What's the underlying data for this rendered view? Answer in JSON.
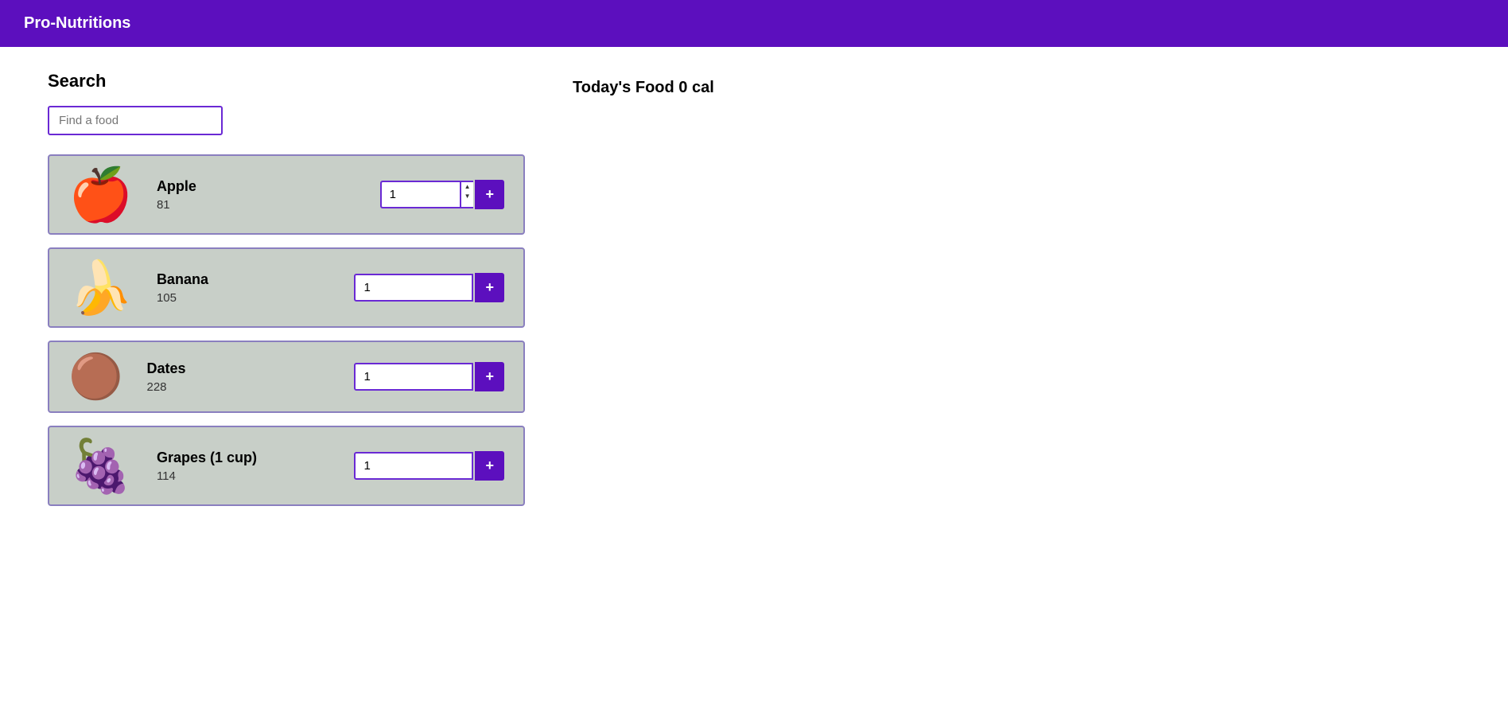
{
  "header": {
    "title": "Pro-Nutritions"
  },
  "search": {
    "section_label": "Search",
    "placeholder": "Find a food"
  },
  "foods": [
    {
      "name": "Apple",
      "calories": "81",
      "quantity": "1",
      "emoji": "🍎",
      "has_spinner": true
    },
    {
      "name": "Banana",
      "calories": "105",
      "quantity": "1",
      "emoji": "🍌",
      "has_spinner": false
    },
    {
      "name": "Dates",
      "calories": "228",
      "quantity": "1",
      "emoji": "🟤",
      "has_spinner": false
    },
    {
      "name": "Grapes (1 cup)",
      "calories": "114",
      "quantity": "1",
      "emoji": "🍇",
      "has_spinner": false
    }
  ],
  "right_panel": {
    "today_food_label": "Today's Food 0 cal"
  },
  "buttons": {
    "add_label": "+"
  }
}
